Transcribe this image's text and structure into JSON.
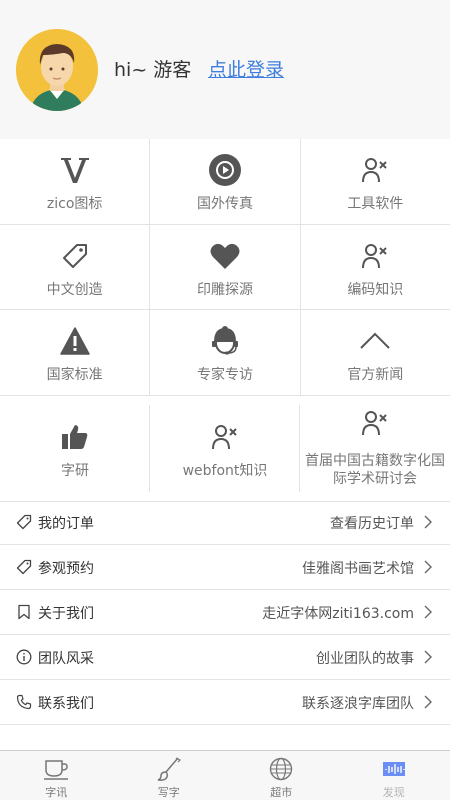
{
  "header": {
    "greeting": "hi~ 游客",
    "login_link": "点此登录"
  },
  "grid": {
    "items": [
      {
        "label": "zico图标",
        "icon": "v-logo-icon"
      },
      {
        "label": "国外传真",
        "icon": "play-circle-icon"
      },
      {
        "label": "工具软件",
        "icon": "user-remove-icon"
      },
      {
        "label": "中文创造",
        "icon": "tag-icon"
      },
      {
        "label": "印雕探源",
        "icon": "heart-icon"
      },
      {
        "label": "编码知识",
        "icon": "user-remove-icon"
      },
      {
        "label": "国家标准",
        "icon": "warning-icon"
      },
      {
        "label": "专家专访",
        "icon": "support-agent-icon"
      },
      {
        "label": "官方新闻",
        "icon": "chevron-up-icon"
      },
      {
        "label": "字研",
        "icon": "thumbs-up-icon"
      },
      {
        "label": "webfont知识",
        "icon": "user-remove-icon"
      },
      {
        "label": "首届中国古籍数字化国际学术研讨会",
        "icon": "user-remove-icon"
      }
    ]
  },
  "list": {
    "items": [
      {
        "label": "我的订单",
        "value": "查看历史订单",
        "icon": "tag-icon"
      },
      {
        "label": "参观预约",
        "value": "佳雅阁书画艺术馆",
        "icon": "tag-icon"
      },
      {
        "label": "关于我们",
        "value": "走近字体网ziti163.com",
        "icon": "bookmark-icon"
      },
      {
        "label": "团队风采",
        "value": "创业团队的故事",
        "icon": "info-icon"
      },
      {
        "label": "联系我们",
        "value": "联系逐浪字库团队",
        "icon": "phone-icon"
      }
    ]
  },
  "tabbar": {
    "tabs": [
      {
        "label": "字讯",
        "icon": "coffee-cup-icon"
      },
      {
        "label": "写字",
        "icon": "brush-icon"
      },
      {
        "label": "超市",
        "icon": "globe-icon"
      },
      {
        "label": "发现",
        "icon": "equalizer-icon",
        "active": true
      }
    ]
  },
  "colors": {
    "accent": "#3e7ede",
    "icon": "#555555",
    "avatar_bg": "#f3c13c",
    "active_tab_icon": "#6a8ef5"
  }
}
